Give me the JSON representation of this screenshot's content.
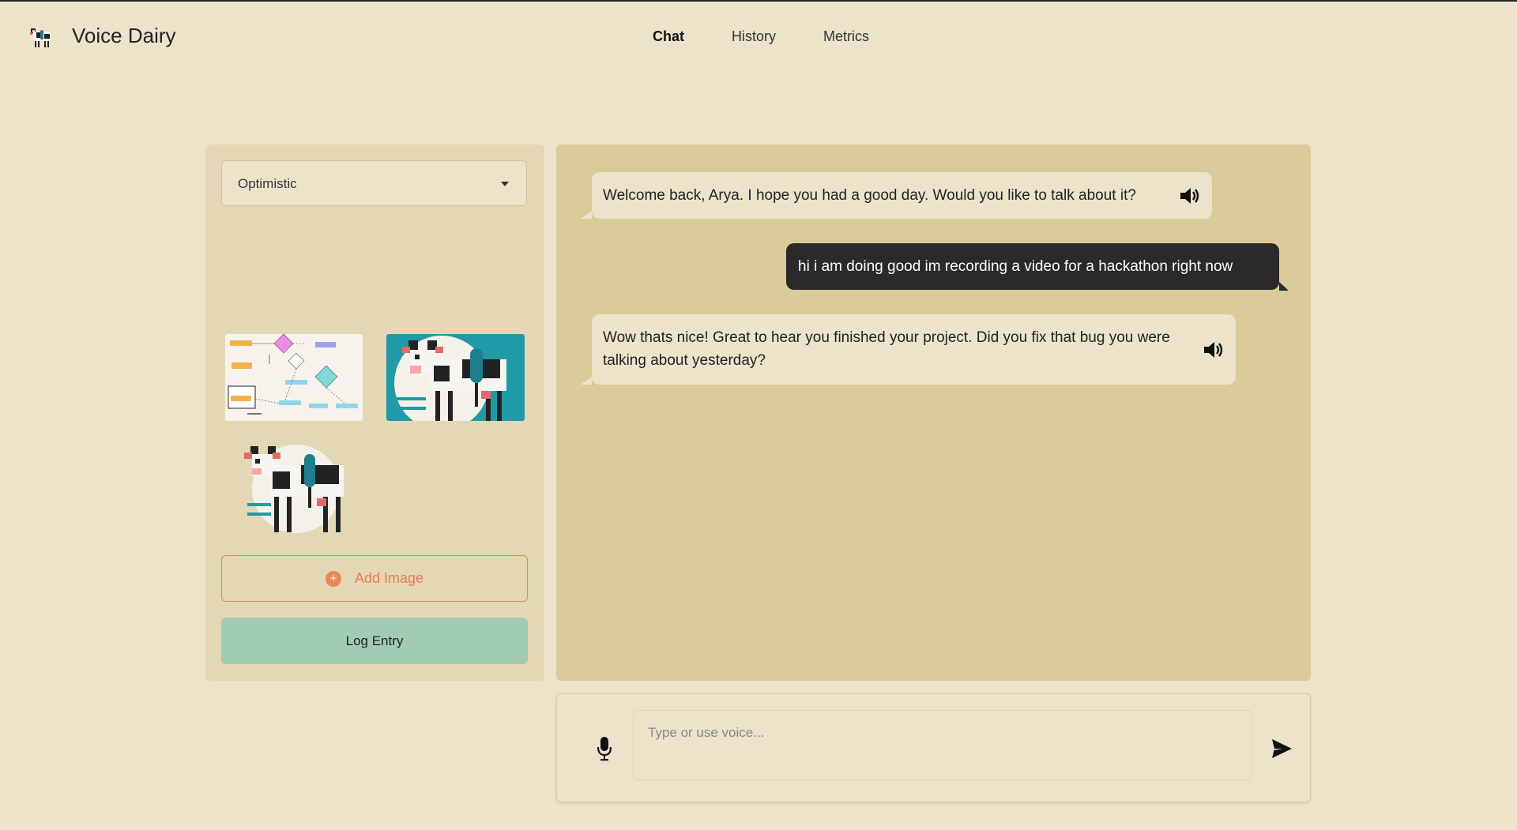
{
  "header": {
    "app_title": "Voice Dairy",
    "logo_icon": "cow-microphone-logo",
    "nav": [
      {
        "label": "Chat",
        "active": true
      },
      {
        "label": "History",
        "active": false
      },
      {
        "label": "Metrics",
        "active": false
      }
    ]
  },
  "sidebar": {
    "mood_select": {
      "value": "Optimistic",
      "icon": "chevron-down-icon"
    },
    "images": [
      {
        "icon": "flowchart-thumbnail"
      },
      {
        "icon": "cow-microphone-thumbnail"
      },
      {
        "icon": "cow-microphone-thumbnail"
      }
    ],
    "add_image_label": "Add Image",
    "add_image_icon": "plus-circle-icon",
    "log_entry_label": "Log Entry"
  },
  "chat": {
    "messages": [
      {
        "role": "bot",
        "text": "Welcome back, Arya. I hope you had a good day. Would you like to talk about it?",
        "icon": "speaker-icon"
      },
      {
        "role": "user",
        "text": "hi i am doing good im recording a video for a hackathon right now"
      },
      {
        "role": "bot",
        "text": "Wow thats nice! Great to hear you finished your project. Did you fix that bug you were talking about yesterday?",
        "icon": "speaker-icon"
      }
    ]
  },
  "composer": {
    "placeholder": "Type or use voice...",
    "value": "",
    "mic_icon": "microphone-icon",
    "send_icon": "send-icon"
  },
  "colors": {
    "background": "#ede3cb",
    "sidebar": "#e4d7b5",
    "chat_area": "#dbcb9a",
    "user_bubble": "#2b2929",
    "accent_orange": "#e0804d",
    "log_button": "#a1cbb5"
  }
}
